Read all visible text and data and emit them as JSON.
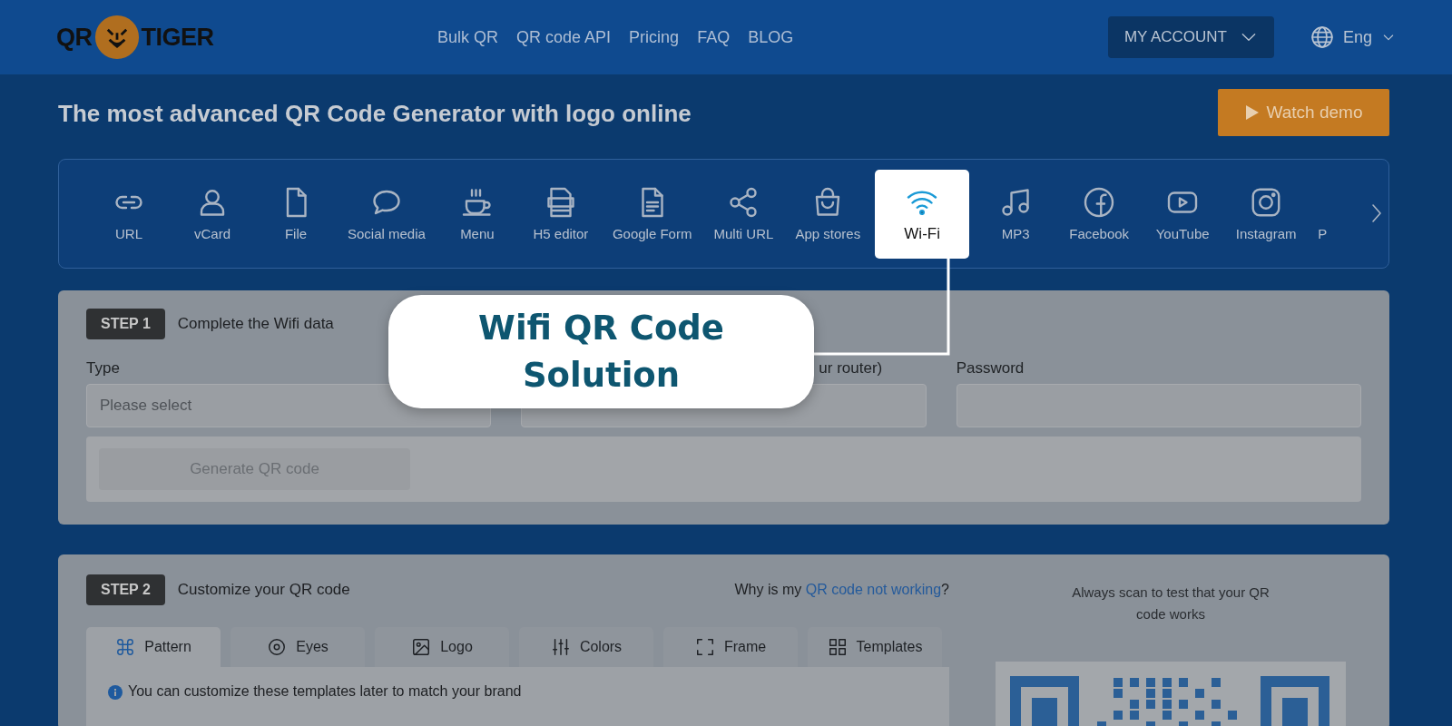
{
  "header": {
    "logo": {
      "left": "QR",
      "right": "TIGER"
    },
    "nav": [
      "Bulk QR",
      "QR code API",
      "Pricing",
      "FAQ",
      "BLOG"
    ],
    "account_button": "MY ACCOUNT",
    "language": "Eng"
  },
  "title": "The most advanced QR Code Generator with logo online",
  "watch_demo": "Watch demo",
  "type_tabs": [
    {
      "label": "URL",
      "selected": false
    },
    {
      "label": "vCard",
      "selected": false
    },
    {
      "label": "File",
      "selected": false
    },
    {
      "label": "Social media",
      "selected": false
    },
    {
      "label": "Menu",
      "selected": false
    },
    {
      "label": "H5 editor",
      "selected": false
    },
    {
      "label": "Google Form",
      "selected": false
    },
    {
      "label": "Multi URL",
      "selected": false
    },
    {
      "label": "App stores",
      "selected": false
    },
    {
      "label": "Wi-Fi",
      "selected": true
    },
    {
      "label": "MP3",
      "selected": false
    },
    {
      "label": "Facebook",
      "selected": false
    },
    {
      "label": "YouTube",
      "selected": false
    },
    {
      "label": "Instagram",
      "selected": false
    },
    {
      "label": "P",
      "selected": false
    }
  ],
  "callout": "Wifi QR Code Solution",
  "step1": {
    "badge": "STEP 1",
    "heading": "Complete the Wifi data",
    "fields": [
      {
        "label": "Type",
        "placeholder": "Please select"
      },
      {
        "label": "ur router)"
      },
      {
        "label": "Password"
      }
    ],
    "generate_button": "Generate QR code"
  },
  "step2": {
    "badge": "STEP 2",
    "heading": "Customize your QR code",
    "help_text": "Why is my",
    "help_link": "QR code not working",
    "help_end": "?",
    "tabs": [
      {
        "label": "Pattern",
        "selected": true
      },
      {
        "label": "Eyes",
        "selected": false
      },
      {
        "label": "Logo",
        "selected": false
      },
      {
        "label": "Colors",
        "selected": false
      },
      {
        "label": "Frame",
        "selected": false
      },
      {
        "label": "Templates",
        "selected": false
      }
    ],
    "info": "You can customize these templates later to match your brand",
    "scan_hint": "Always scan to test that your QR code works"
  }
}
